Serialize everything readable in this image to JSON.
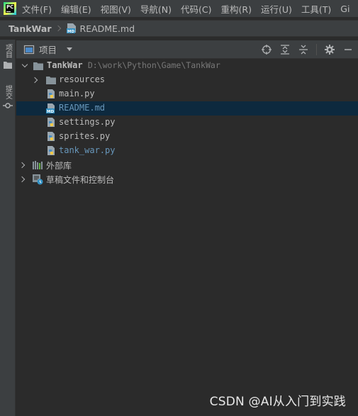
{
  "menubar": {
    "items": [
      "文件(F)",
      "编辑(E)",
      "视图(V)",
      "导航(N)",
      "代码(C)",
      "重构(R)",
      "运行(U)",
      "工具(T)",
      "Gi"
    ]
  },
  "breadcrumb": {
    "project": "TankWar",
    "file": "README.md"
  },
  "stripe": {
    "project_tab": "项目",
    "commit_tab": "提交"
  },
  "toolwindow": {
    "title": "项目"
  },
  "tree": {
    "root": {
      "name": "TankWar",
      "path": "D:\\work\\Python\\Game\\TankWar"
    },
    "items": [
      {
        "label": "resources",
        "color": "#bbbbbb"
      },
      {
        "label": "main.py",
        "color": "#bbbbbb"
      },
      {
        "label": "README.md",
        "color": "#6897bb"
      },
      {
        "label": "settings.py",
        "color": "#bbbbbb"
      },
      {
        "label": "sprites.py",
        "color": "#bbbbbb"
      },
      {
        "label": "tank_war.py",
        "color": "#6897bb"
      }
    ],
    "external_libraries": "外部库",
    "scratches": "草稿文件和控制台"
  },
  "colors": {
    "selection": "#0d293e",
    "modified_file": "#6897bb",
    "background": "#2b2b2b",
    "panel": "#3c3f41"
  },
  "watermark": "CSDN @AI从入门到实践"
}
